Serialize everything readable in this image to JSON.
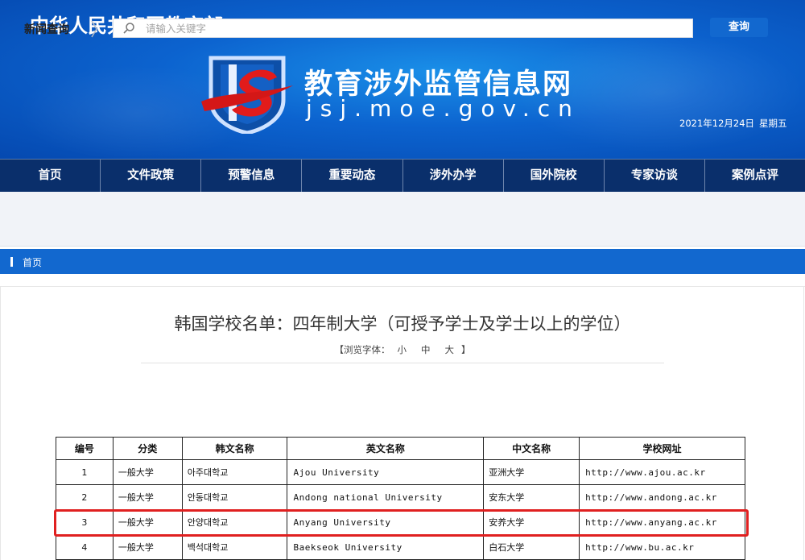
{
  "banner": {
    "ministry": "中华人民共和国教育部",
    "site_name": "教育涉外监管信息网",
    "site_domain": "jsj.moe.gov.cn",
    "date": "2021年12月24日",
    "weekday": "星期五",
    "logo_icon": "shield-js-logo-icon"
  },
  "nav": {
    "items": [
      "首页",
      "文件政策",
      "预警信息",
      "重要动态",
      "涉外办学",
      "国外院校",
      "专家访谈",
      "案例点评"
    ]
  },
  "search": {
    "title": "新闻查询",
    "placeholder": "请输入关键字",
    "button": "查询"
  },
  "breadcrumb": {
    "home": "首页"
  },
  "article": {
    "title": "韩国学校名单：四年制大学（可授予学士及学士以上的学位）",
    "font_size_prefix": "【浏览字体：",
    "font_small": "小",
    "font_medium": "中",
    "font_large": "大",
    "font_size_suffix": "】"
  },
  "table": {
    "headers": [
      "编号",
      "分类",
      "韩文名称",
      "英文名称",
      "中文名称",
      "学校网址"
    ],
    "rows": [
      {
        "num": "1",
        "cat": "一般大学",
        "ko": "아주대학교",
        "en": "Ajou University",
        "cn": "亚洲大学",
        "url": "http://www.ajou.ac.kr"
      },
      {
        "num": "2",
        "cat": "一般大学",
        "ko": "안동대학교",
        "en": "Andong national University",
        "cn": "安东大学",
        "url": "http://www.andong.ac.kr"
      },
      {
        "num": "3",
        "cat": "一般大学",
        "ko": "안양대학교",
        "en": "Anyang University",
        "cn": "安养大学",
        "url": "http://www.anyang.ac.kr"
      },
      {
        "num": "4",
        "cat": "一般大学",
        "ko": "백석대학교",
        "en": "Baekseok University",
        "cn": "白石大学",
        "url": "http://www.bu.ac.kr"
      }
    ],
    "highlight_color": "#e02020"
  },
  "colors": {
    "nav_bg": "#0a2f6b",
    "accent": "#1268cf",
    "banner": "#0c63cf"
  }
}
